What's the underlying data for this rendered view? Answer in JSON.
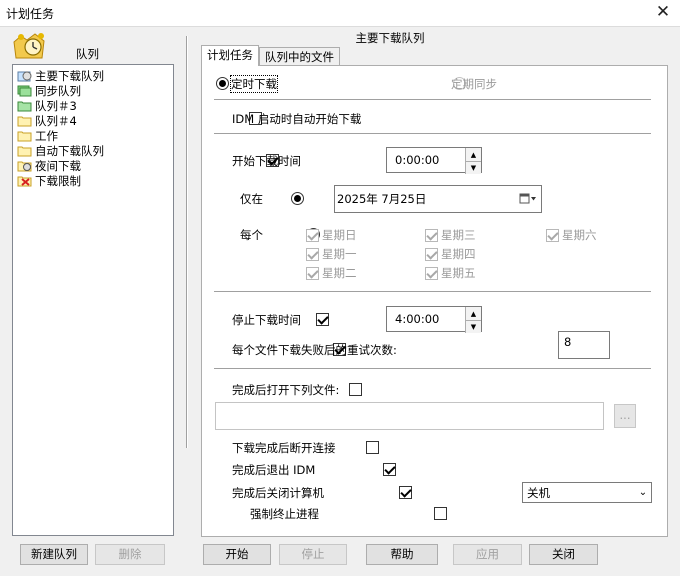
{
  "window": {
    "title": "计划任务",
    "close_glyph": "✕"
  },
  "queue_panel": {
    "label": "队列",
    "items": [
      {
        "label": "主要下载队列",
        "icon": "main-queue-icon"
      },
      {
        "label": "同步队列",
        "icon": "sync-queue-icon"
      },
      {
        "label": "队列＃3",
        "icon": "folder-icon"
      },
      {
        "label": "队列＃4",
        "icon": "folder-icon"
      },
      {
        "label": "工作",
        "icon": "folder-icon"
      },
      {
        "label": "自动下载队列",
        "icon": "folder-icon"
      },
      {
        "label": "夜间下载",
        "icon": "night-queue-icon"
      },
      {
        "label": "下载限制",
        "icon": "limit-icon"
      }
    ],
    "new_queue_button": "新建队列",
    "delete_button": "删除"
  },
  "main": {
    "title": "主要下载队列",
    "tabs": [
      {
        "label": "计划任务"
      },
      {
        "label": "队列中的文件"
      }
    ],
    "mode": {
      "once_label": "定时下载",
      "periodic_label": "定期同步",
      "selected": "once"
    },
    "idm_start_label": "IDM 启动时自动开始下载",
    "start_time": {
      "label": "开始下载时间",
      "value": "0:00:00",
      "checked": true
    },
    "only_on": {
      "label": "仅在",
      "date": "2025年  7月25日",
      "selected": true
    },
    "every": {
      "label": "每个",
      "days": [
        {
          "label": "星期日",
          "checked": true
        },
        {
          "label": "星期一",
          "checked": true
        },
        {
          "label": "星期二",
          "checked": true
        },
        {
          "label": "星期三",
          "checked": true
        },
        {
          "label": "星期四",
          "checked": true
        },
        {
          "label": "星期五",
          "checked": true
        },
        {
          "label": "星期六",
          "checked": true
        }
      ]
    },
    "stop_time": {
      "label": "停止下载时间",
      "value": "4:00:00",
      "checked": true
    },
    "retry": {
      "label": "每个文件下载失败后的重试次数:",
      "value": "8",
      "checked": true
    },
    "open_file": {
      "label": "完成后打开下列文件:",
      "value": "",
      "browse": "...",
      "checked": false
    },
    "hangup_label": "下载完成后断开连接",
    "exit_idm_label": "完成后退出 IDM",
    "shutdown": {
      "label": "完成后关闭计算机",
      "option": "关机"
    },
    "force_label": "强制终止进程"
  },
  "buttons": {
    "start": "开始",
    "stop": "停止",
    "help": "帮助",
    "apply": "应用",
    "close": "关闭"
  },
  "colors": {
    "window_bg": "#f0f0f0",
    "accent_green": "#5cb85c",
    "folder_yellow": "#f6d365",
    "limit_red": "#d9534f"
  }
}
